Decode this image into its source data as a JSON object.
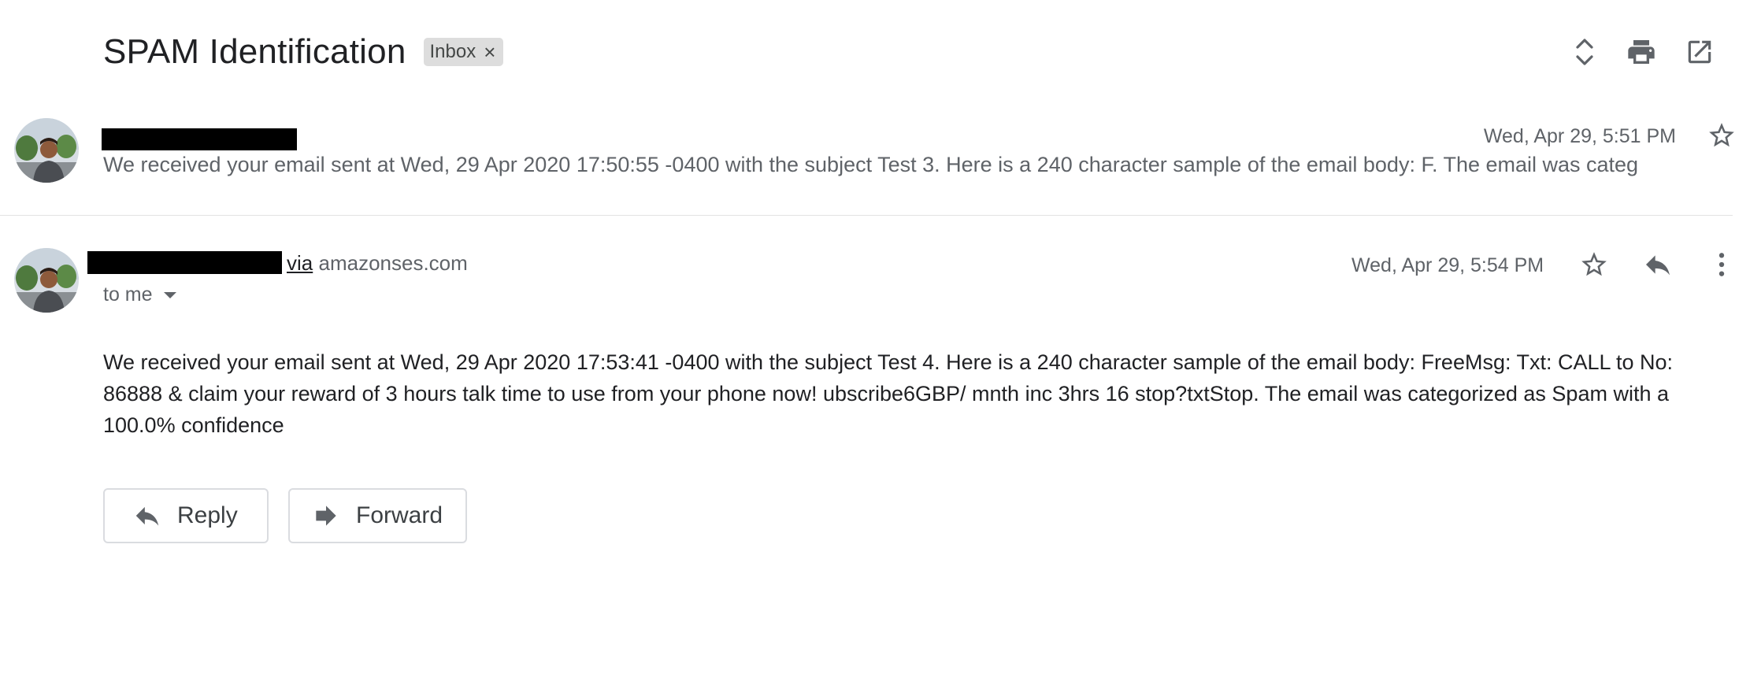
{
  "thread": {
    "subject": "SPAM Identification",
    "label_chip": "Inbox",
    "label_remove_glyph": "×"
  },
  "toolbar_icons": [
    "expand-all-icon",
    "print-icon",
    "open-in-new-window-icon"
  ],
  "messages": [
    {
      "state": "collapsed",
      "sender": "",
      "date": "Wed, Apr 29, 5:51 PM",
      "snippet": "We received your email sent at Wed, 29 Apr 2020 17:50:55 -0400 with the subject Test 3. Here is a 240 character sample of the email body: F. The email was categ",
      "icons": [
        "star-icon"
      ]
    },
    {
      "state": "expanded",
      "sender": "",
      "via_label": "via",
      "via_domain": "amazonses.com",
      "recipient": "to me",
      "date": "Wed, Apr 29, 5:54 PM",
      "body": "We received your email sent at Wed, 29 Apr 2020 17:53:41 -0400 with the subject Test 4. Here is a 240 character sample of the email body: FreeMsg: Txt: CALL to No: 86888 & claim your reward of 3 hours talk time to use from your phone now! ubscribe6GBP/ mnth inc 3hrs 16 stop?txtStop. The email was categorized as Spam with a 100.0% confidence",
      "icons": [
        "star-icon",
        "reply-icon",
        "more-vert-icon"
      ]
    }
  ],
  "actions": {
    "reply_label": "Reply",
    "forward_label": "Forward"
  },
  "colors": {
    "text_primary": "#202124",
    "text_secondary": "#5f6368",
    "chip_bg": "#dddddd",
    "border": "#dadce0",
    "redaction": "#000000"
  }
}
